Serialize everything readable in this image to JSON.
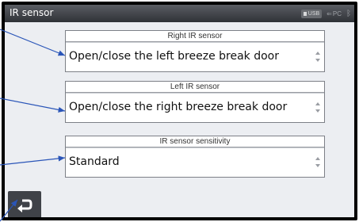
{
  "window": {
    "title": "IR sensor"
  },
  "status_bar": {
    "usb_label": "USB",
    "pc_label": "PC",
    "icons": [
      "usb-icon",
      "pc-connection-icon",
      "bluetooth-icon"
    ]
  },
  "settings": [
    {
      "label": "Right IR sensor",
      "value": "Open/close the left breeze break door"
    },
    {
      "label": "Left IR sensor",
      "value": "Open/close the right breeze break door"
    },
    {
      "label": "IR sensor sensitivity",
      "value": "Standard"
    }
  ],
  "footer": {
    "back_icon": "return-arrow-icon"
  },
  "colors": {
    "annotation_arrow": "#2a55b8",
    "titlebar": "#3a3d42",
    "back_button": "#3f4248"
  }
}
